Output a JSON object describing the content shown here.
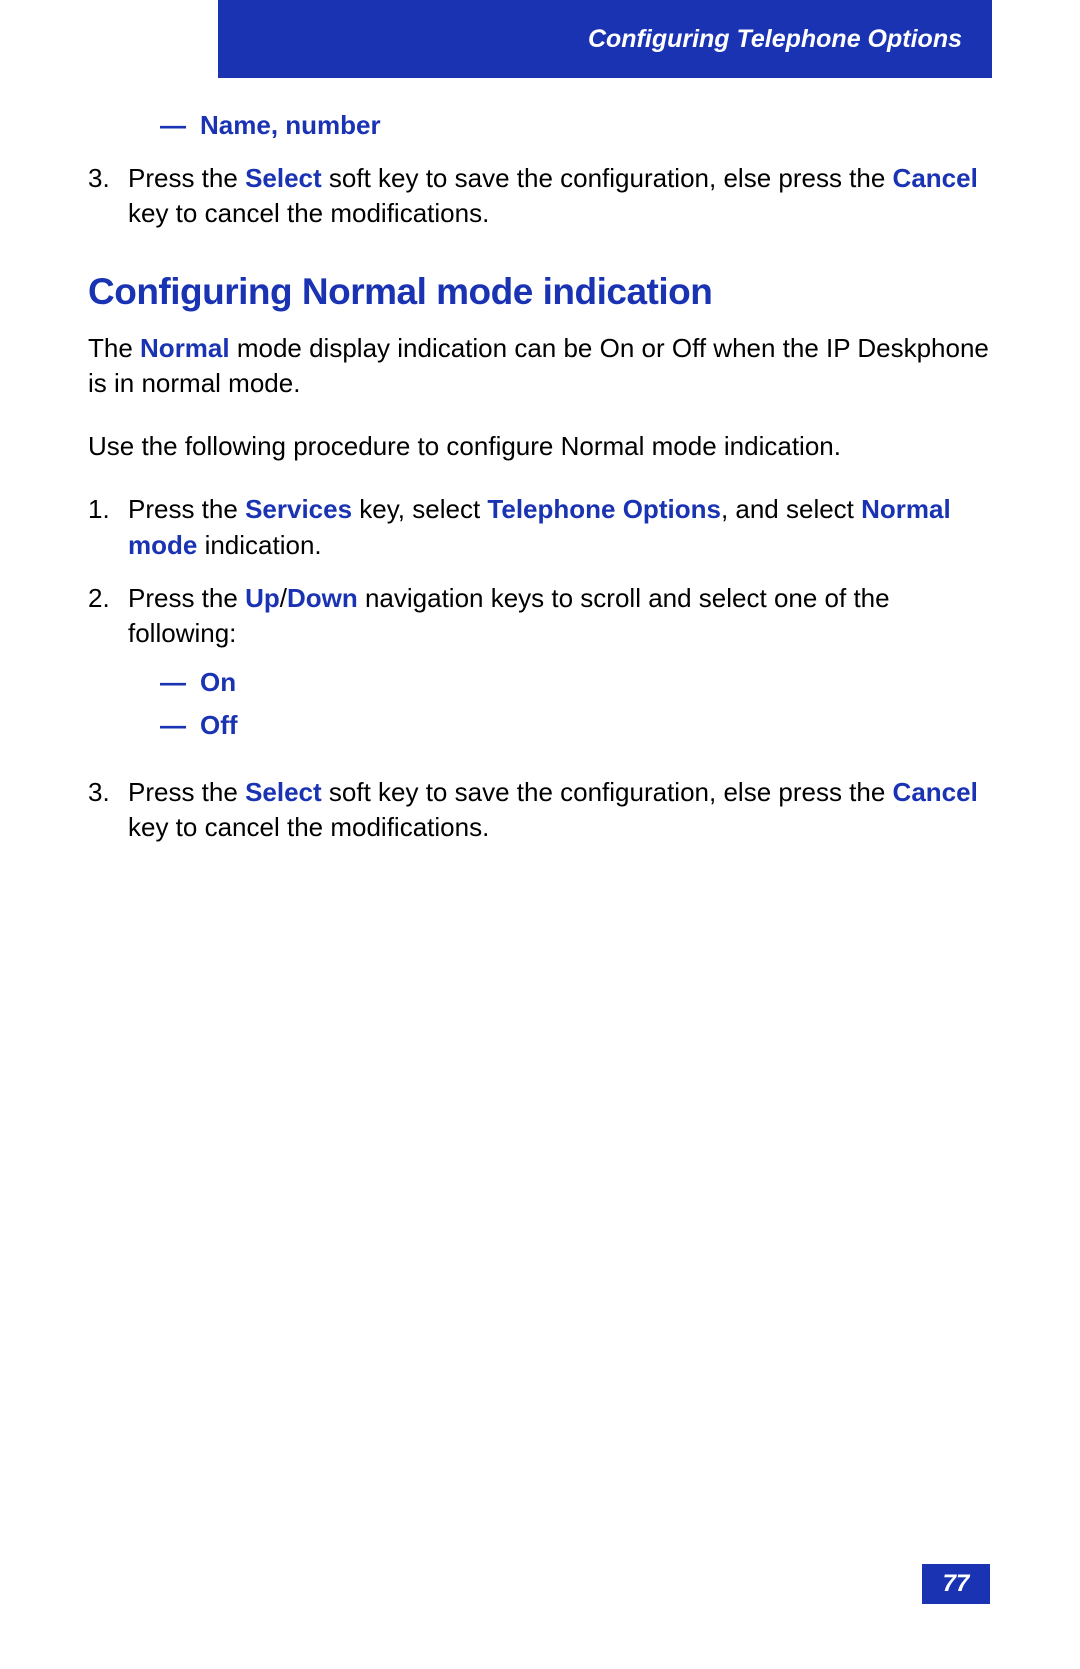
{
  "header": {
    "title": "Configuring Telephone Options"
  },
  "top_section": {
    "bullet_dash": "—",
    "bullet_text": "Name, number",
    "step3_num": "3.",
    "step3_part1": "Press the ",
    "step3_select": "Select",
    "step3_part2": " soft key to save the configuration, else press the ",
    "step3_cancel": "Cancel",
    "step3_part3": " key to cancel the modifications."
  },
  "heading": "Configuring Normal mode indication",
  "para1_part1": "The ",
  "para1_normal": "Normal",
  "para1_part2": " mode display indication can be On or Off when the IP Deskphone is in normal mode.",
  "para2": "Use the following procedure to configure Normal mode indication.",
  "steps": {
    "s1_num": "1.",
    "s1_part1": "Press the ",
    "s1_services": "Services",
    "s1_part2": " key, select ",
    "s1_tel_opts": "Telephone Options",
    "s1_part3": ", and select ",
    "s1_normal_mode": "Normal mode",
    "s1_part4": " indication.",
    "s2_num": "2.",
    "s2_part1": "Press the ",
    "s2_up": "Up",
    "s2_slash": "/",
    "s2_down": "Down",
    "s2_part2": " navigation keys to scroll and select one of the following:",
    "s2_bullet_dash": "—",
    "s2_on": "On",
    "s2_off": "Off",
    "s3_num": "3.",
    "s3_part1": "Press the ",
    "s3_select": "Select",
    "s3_part2": " soft key to save the configuration, else press the ",
    "s3_cancel": "Cancel",
    "s3_part3": " key to cancel the modifications."
  },
  "page_number": "77"
}
